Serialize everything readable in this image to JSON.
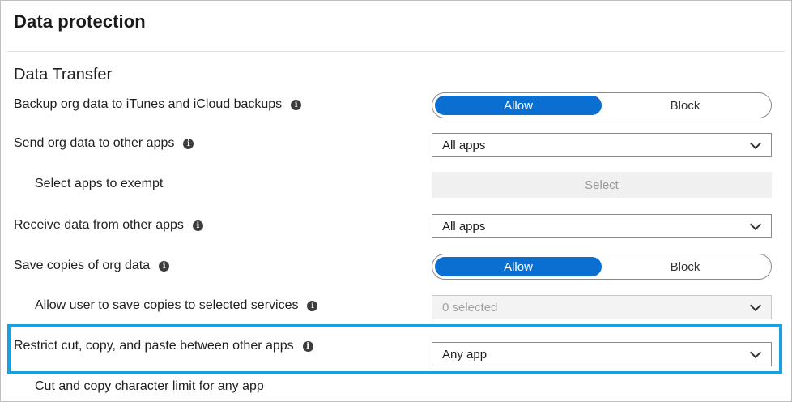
{
  "header": {
    "title": "Data protection"
  },
  "section": {
    "title": "Data Transfer"
  },
  "rows": {
    "backup": {
      "label": "Backup org data to iTunes and iCloud backups",
      "options": [
        "Allow",
        "Block"
      ],
      "selected": "Allow"
    },
    "send": {
      "label": "Send org data to other apps",
      "value": "All apps"
    },
    "exempt": {
      "label": "Select apps to exempt",
      "button": "Select"
    },
    "receive": {
      "label": "Receive data from other apps",
      "value": "All apps"
    },
    "save": {
      "label": "Save copies of org data",
      "options": [
        "Allow",
        "Block"
      ],
      "selected": "Allow"
    },
    "services": {
      "label": "Allow user to save copies to selected services",
      "value": "0 selected"
    },
    "restrict": {
      "label": "Restrict cut, copy, and paste between other apps",
      "value": "Any app"
    },
    "limit": {
      "label": "Cut and copy character limit for any app"
    }
  },
  "colors": {
    "accent": "#0a6fd1",
    "highlight": "#1aa0df"
  },
  "icons": {
    "info": "info-icon",
    "dropdown": "chevron-down-icon"
  }
}
